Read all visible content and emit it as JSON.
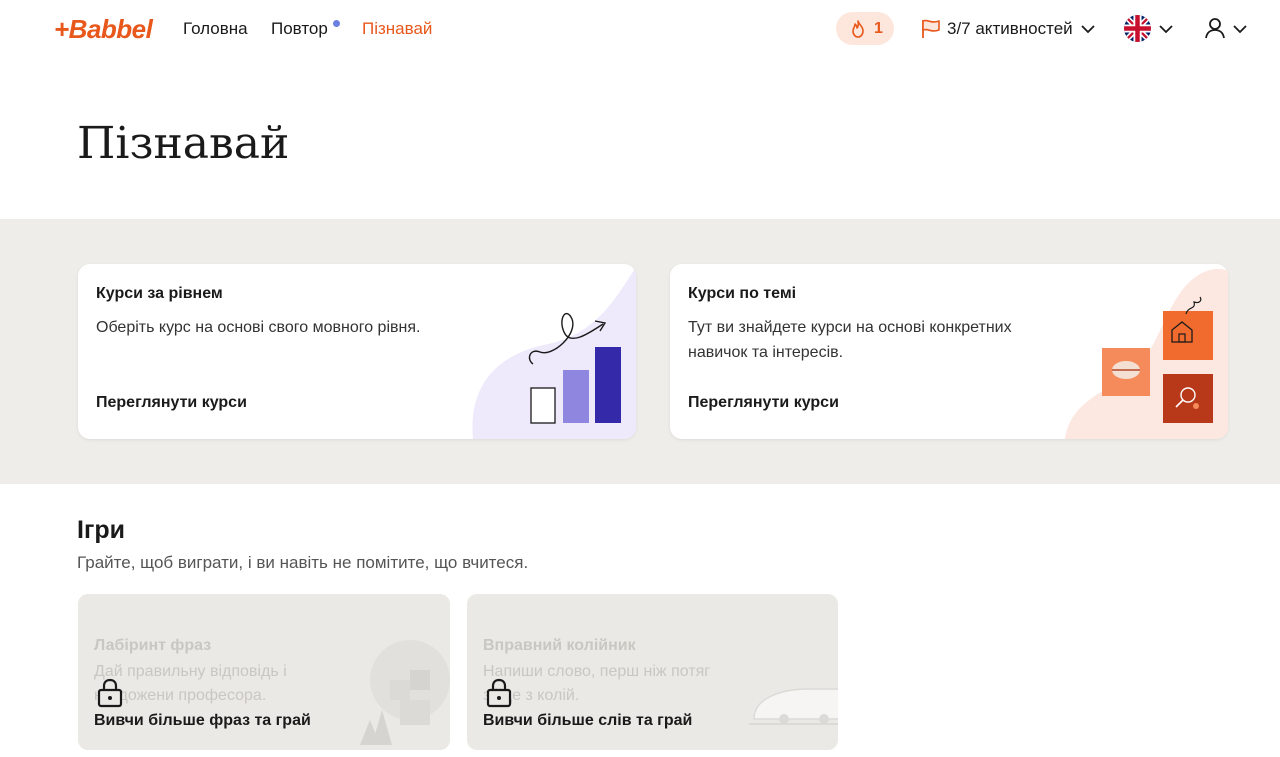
{
  "nav": {
    "logo": "+Babbel",
    "links": [
      "Головна",
      "Повтор",
      "Пізнавай"
    ],
    "streak_count": "1",
    "activities": "3/7 активностей",
    "colors": {
      "accent": "#e8581c",
      "dot": "#6b7fe0"
    }
  },
  "page_title": "Пізнавай",
  "cards": [
    {
      "title": "Курси за рівнем",
      "description": "Оберіть курс на основі свого мовного рівня.",
      "cta": "Переглянути курси"
    },
    {
      "title": "Курси по темі",
      "description_line1": "Тут ви знайдете курси на основі конкретних",
      "description_line2": "навичок та інтересів.",
      "cta": "Переглянути курси"
    }
  ],
  "games": {
    "title": "Ігри",
    "subtitle": "Грайте, щоб виграти, і ви навіть не помітите, що вчитеся.",
    "items": [
      {
        "title": "Лабіринт фраз",
        "desc_line1": "Дай правильну відповідь і",
        "desc_line2": "наздожени професора.",
        "cta": "Вивчи більше фраз та грай"
      },
      {
        "title": "Вправний колійник",
        "desc_line1": "Напиши слово, перш ніж потяг",
        "desc_line2": "зійде з колій.",
        "cta": "Вивчи більше слів та грай"
      }
    ]
  }
}
